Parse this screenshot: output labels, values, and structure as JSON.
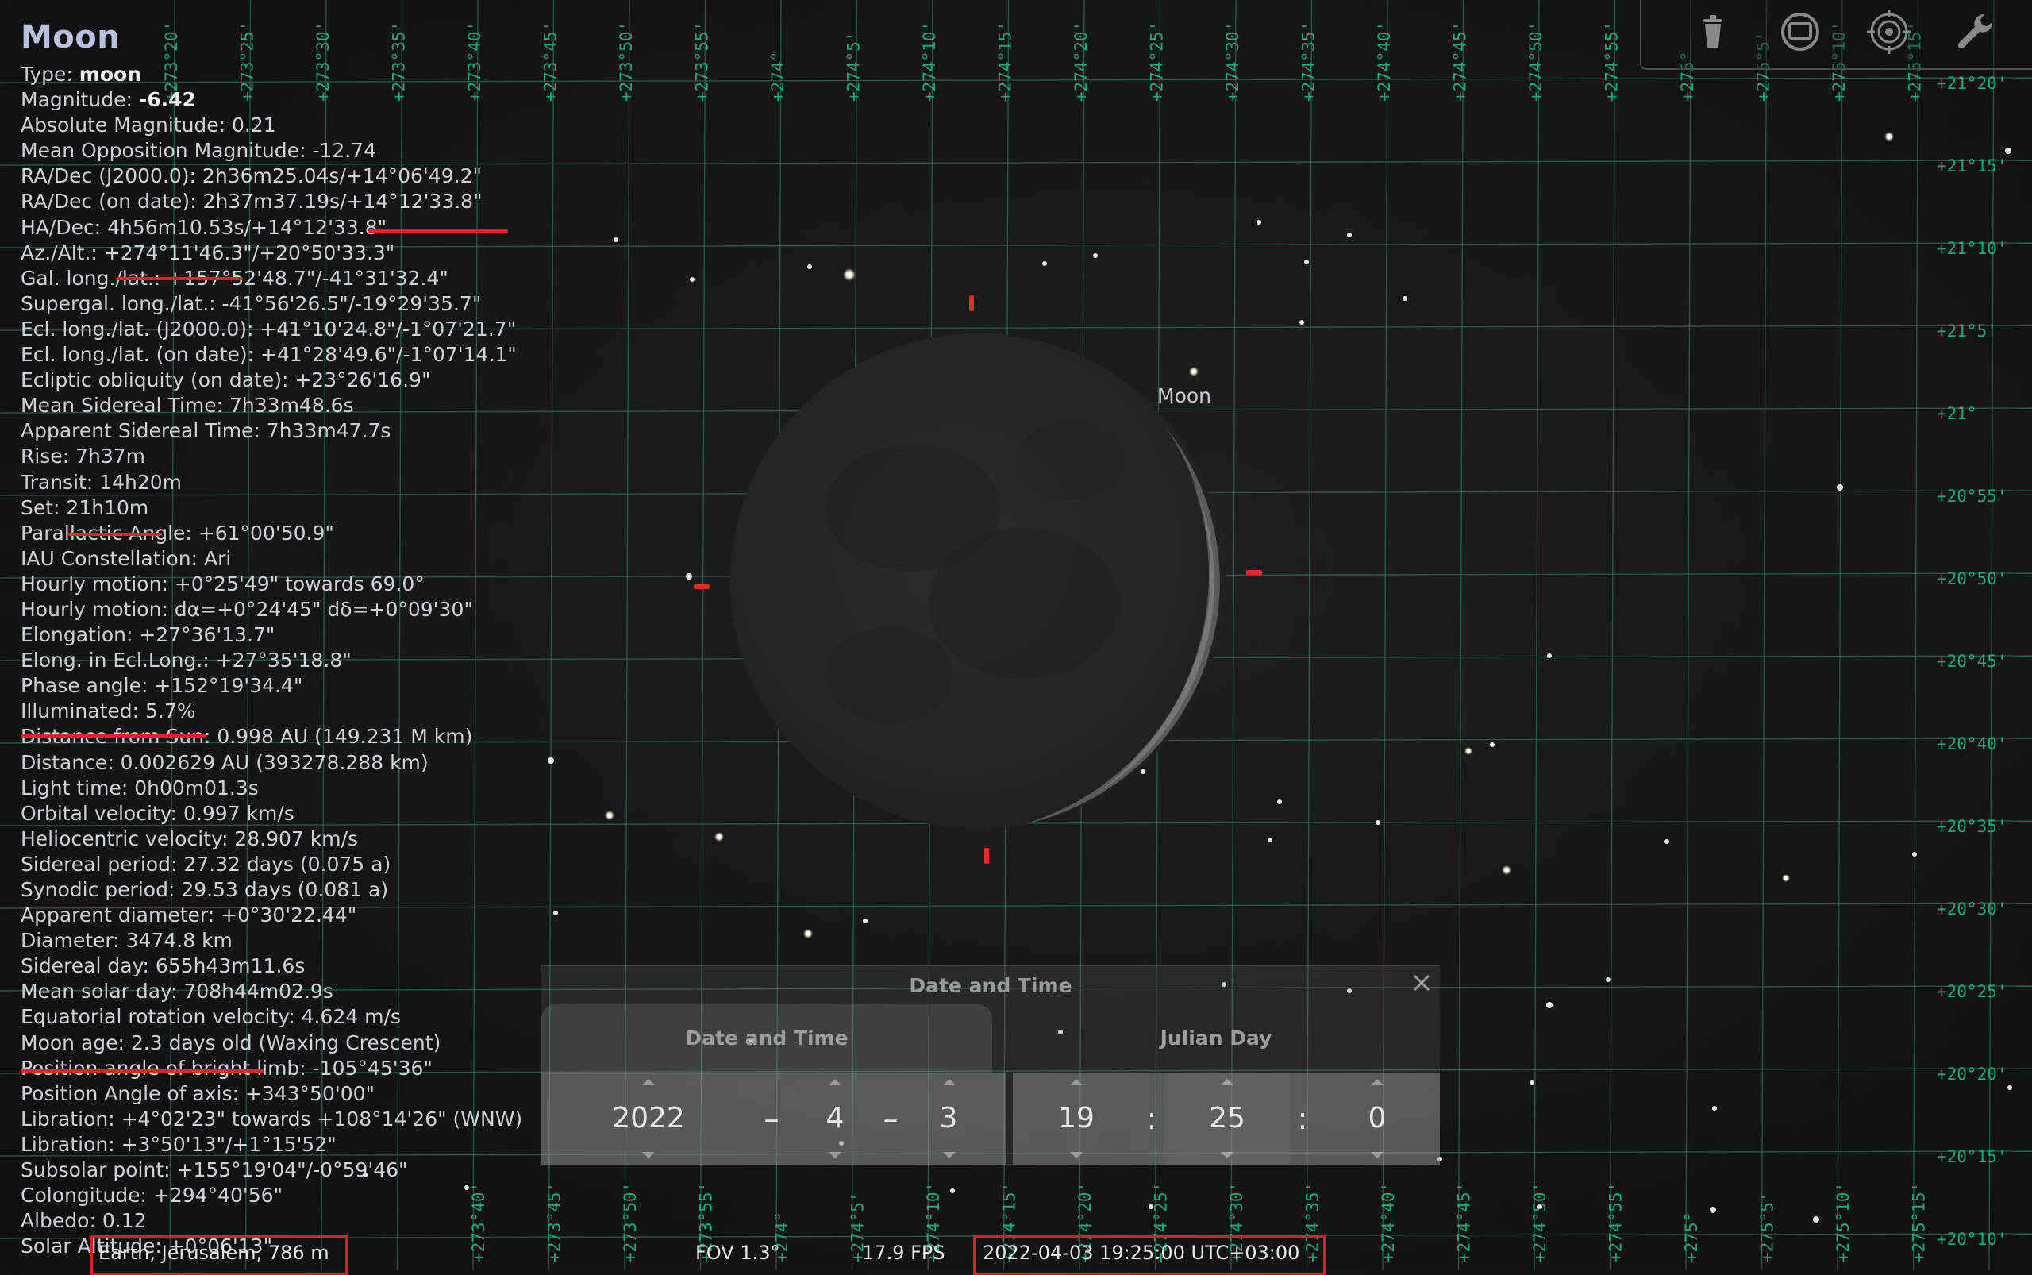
{
  "object": {
    "name": "Moon",
    "rows": [
      {
        "label": "Type:",
        "value": "moon",
        "bold": true
      },
      {
        "label": "Magnitude:",
        "value": "-6.42",
        "bold": true
      },
      {
        "text": "Absolute Magnitude: 0.21"
      },
      {
        "text": "Mean Opposition Magnitude: -12.74"
      },
      {
        "text": "RA/Dec (J2000.0): 2h36m25.04s/+14°06'49.2\""
      },
      {
        "text": "RA/Dec (on date): 2h37m37.19s/+14°12'33.8\""
      },
      {
        "text": "HA/Dec: 4h56m10.53s/+14°12'33.8\""
      },
      {
        "text": "Az./Alt.: +274°11'46.3\"/+20°50'33.3\""
      },
      {
        "text": "Gal. long./lat.: +157°52'48.7\"/-41°31'32.4\""
      },
      {
        "text": "Supergal. long./lat.: -41°56'26.5\"/-19°29'35.7\""
      },
      {
        "text": "Ecl. long./lat. (J2000.0): +41°10'24.8\"/-1°07'21.7\""
      },
      {
        "text": "Ecl. long./lat. (on date): +41°28'49.6\"/-1°07'14.1\""
      },
      {
        "text": "Ecliptic obliquity (on date): +23°26'16.9\""
      },
      {
        "text": "Mean Sidereal Time: 7h33m48.6s"
      },
      {
        "text": "Apparent Sidereal Time: 7h33m47.7s"
      },
      {
        "text": "Rise: 7h37m"
      },
      {
        "text": "Transit: 14h20m"
      },
      {
        "text": "Set: 21h10m"
      },
      {
        "text": "Parallactic Angle: +61°00'50.9\""
      },
      {
        "text": "IAU Constellation: Ari"
      },
      {
        "text": "Hourly motion: +0°25'49\" towards 69.0°"
      },
      {
        "text": "Hourly motion: dα=+0°24'45\" dδ=+0°09'30\""
      },
      {
        "text": "Elongation: +27°36'13.7\""
      },
      {
        "text": "Elong. in Ecl.Long.: +27°35'18.8\""
      },
      {
        "text": "Phase angle: +152°19'34.4\""
      },
      {
        "text": "Illuminated: 5.7%"
      },
      {
        "text": "Distance from Sun: 0.998 AU (149.231 M km)"
      },
      {
        "text": "Distance: 0.002629 AU (393278.288 km)"
      },
      {
        "text": "Light time: 0h00m01.3s"
      },
      {
        "text": "Orbital velocity: 0.997 km/s"
      },
      {
        "text": "Heliocentric velocity: 28.907 km/s"
      },
      {
        "text": "Sidereal period: 27.32 days (0.075 a)"
      },
      {
        "text": "Synodic period: 29.53 days (0.081 a)"
      },
      {
        "text": "Apparent diameter: +0°30'22.44\""
      },
      {
        "text": "Diameter: 3474.8 km"
      },
      {
        "text": "Sidereal day: 655h43m11.6s"
      },
      {
        "text": "Mean solar day: 708h44m02.9s"
      },
      {
        "text": "Equatorial rotation velocity: 4.624 m/s"
      },
      {
        "text": "Moon age: 2.3 days old (Waxing Crescent)"
      },
      {
        "text": "Position angle of bright limb: -105°45'36\""
      },
      {
        "text": "Position Angle of axis: +343°50'00\""
      },
      {
        "text": "Libration: +4°02'23\" towards +108°14'26\" (WNW)"
      },
      {
        "text": "Libration: +3°50'13\"/+1°15'52\""
      },
      {
        "text": "Subsolar point: +155°19'04\"/-0°59'46\""
      },
      {
        "text": "Colongitude: +294°40'56\""
      },
      {
        "text": "Albedo: 0.12"
      },
      {
        "text": "Solar Altitude: +0°06'13\""
      }
    ]
  },
  "sky_label": "Moon",
  "grid": {
    "top_labels": [
      "+273°20'",
      "+273°25'",
      "+273°30'",
      "+273°35'",
      "+273°40'",
      "+273°45'",
      "+273°50'",
      "+273°55'",
      "+274°",
      "+274°5'",
      "+274°10'",
      "+274°15'",
      "+274°20'",
      "+274°25'",
      "+274°30'",
      "+274°35'",
      "+274°40'",
      "+274°45'",
      "+274°50'",
      "+274°55'",
      "+275°",
      "+275°5'",
      "+275°10'",
      "+275°15'"
    ],
    "bottom_labels": [
      "+273°40'",
      "+273°45'",
      "+273°50'",
      "+273°55'",
      "+274°",
      "+274°5'",
      "+274°10'",
      "+274°15'",
      "+274°20'",
      "+274°25'",
      "+274°30'",
      "+274°35'",
      "+274°40'",
      "+274°45'",
      "+274°50'",
      "+274°55'",
      "+275°",
      "+275°5'",
      "+275°10'",
      "+275°15'"
    ],
    "right_labels": [
      "+21°20'",
      "+21°15'",
      "+21°10'",
      "+21°5'",
      "+21°",
      "+20°55'",
      "+20°50'",
      "+20°45'",
      "+20°40'",
      "+20°35'",
      "+20°30'",
      "+20°25'",
      "+20°20'",
      "+20°15'",
      "+20°10'"
    ]
  },
  "toolbar": {
    "icons": [
      "trash-can-icon",
      "screen-window-icon",
      "target-reticle-icon",
      "wrench-icon"
    ]
  },
  "date_dialog": {
    "title": "Date and Time",
    "tabs": [
      "Date and Time",
      "Julian Day"
    ],
    "year": "2022",
    "month": "4",
    "day": "3",
    "hour": "19",
    "minute": "25",
    "second": "0",
    "date_sep": "–",
    "time_sep": ":"
  },
  "status": {
    "location": "Earth, Jerusalem, 786 m",
    "fov": "FOV 1.3°",
    "fps": "17.9 FPS",
    "datetime": "2022-04-03 19:25:00 UTC+03:00"
  },
  "colors": {
    "grid": "#2f6a5a",
    "grid_label": "#1fa877",
    "highlight": "#e2212b",
    "title": "#b8c0de"
  }
}
